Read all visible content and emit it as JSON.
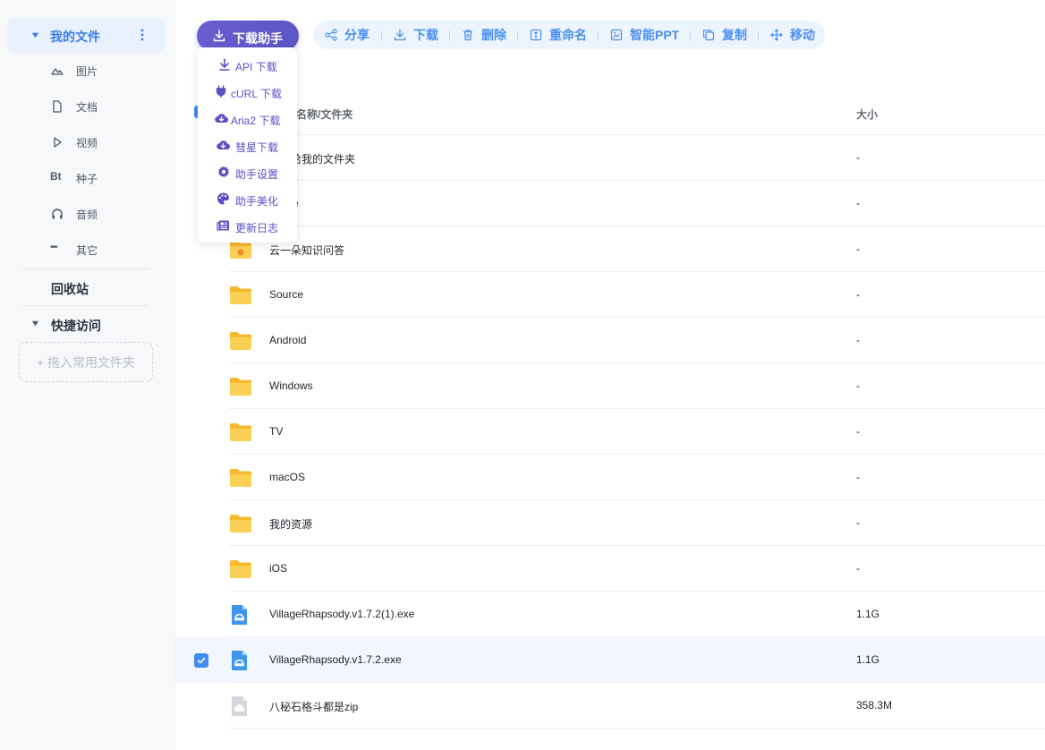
{
  "sidebar": {
    "my_files": "我的文件",
    "items": [
      {
        "label": "图片",
        "icon": "image-icon"
      },
      {
        "label": "文档",
        "icon": "document-icon"
      },
      {
        "label": "视频",
        "icon": "video-icon"
      },
      {
        "label": "种子",
        "icon": "torrent-icon"
      },
      {
        "label": "音频",
        "icon": "audio-icon"
      },
      {
        "label": "其它",
        "icon": "more-icon"
      }
    ],
    "torrent_glyph": "Bt",
    "other_glyph": "•••",
    "recycle": "回收站",
    "quick_access": "快捷访问",
    "drop_hint": "+ 拖入常用文件夹"
  },
  "toolbar": {
    "download_helper": "下载助手",
    "actions": [
      "分享",
      "下载",
      "删除",
      "重命名",
      "智能PPT",
      "复制",
      "移动"
    ]
  },
  "menu": {
    "items": [
      "API 下载",
      "cURL 下载",
      "Aria2 下载",
      "彗星下载",
      "助手设置",
      "助手美化",
      "更新日志"
    ]
  },
  "table": {
    "col_name": "名称/文件夹",
    "col_size": "大小",
    "rows": [
      {
        "name": "分享给我的文件夹",
        "size": "-",
        "type": "shared-folder",
        "selected": false
      },
      {
        "name": "Game",
        "size": "-",
        "type": "folder",
        "selected": false
      },
      {
        "name": "云一朵知识问答",
        "size": "-",
        "type": "special-folder",
        "selected": false
      },
      {
        "name": "Source",
        "size": "-",
        "type": "folder",
        "selected": false
      },
      {
        "name": "Android",
        "size": "-",
        "type": "folder",
        "selected": false
      },
      {
        "name": "Windows",
        "size": "-",
        "type": "folder",
        "selected": false
      },
      {
        "name": "TV",
        "size": "-",
        "type": "folder",
        "selected": false
      },
      {
        "name": "macOS",
        "size": "-",
        "type": "folder",
        "selected": false
      },
      {
        "name": "我的资源",
        "size": "-",
        "type": "folder",
        "selected": false
      },
      {
        "name": "iOS",
        "size": "-",
        "type": "folder",
        "selected": false
      },
      {
        "name": "VillageRhapsody.v1.7.2(1).exe",
        "size": "1.1G",
        "type": "exe",
        "selected": false
      },
      {
        "name": "VillageRhapsody.v1.7.2.exe",
        "size": "1.1G",
        "type": "exe",
        "selected": true
      },
      {
        "name": "八秘石格斗都是zip",
        "size": "358.3M",
        "type": "zip",
        "selected": false
      }
    ]
  },
  "colors": {
    "accent": "#3a7be8",
    "helper": "#5b56c6",
    "folder": "#f7c844"
  }
}
